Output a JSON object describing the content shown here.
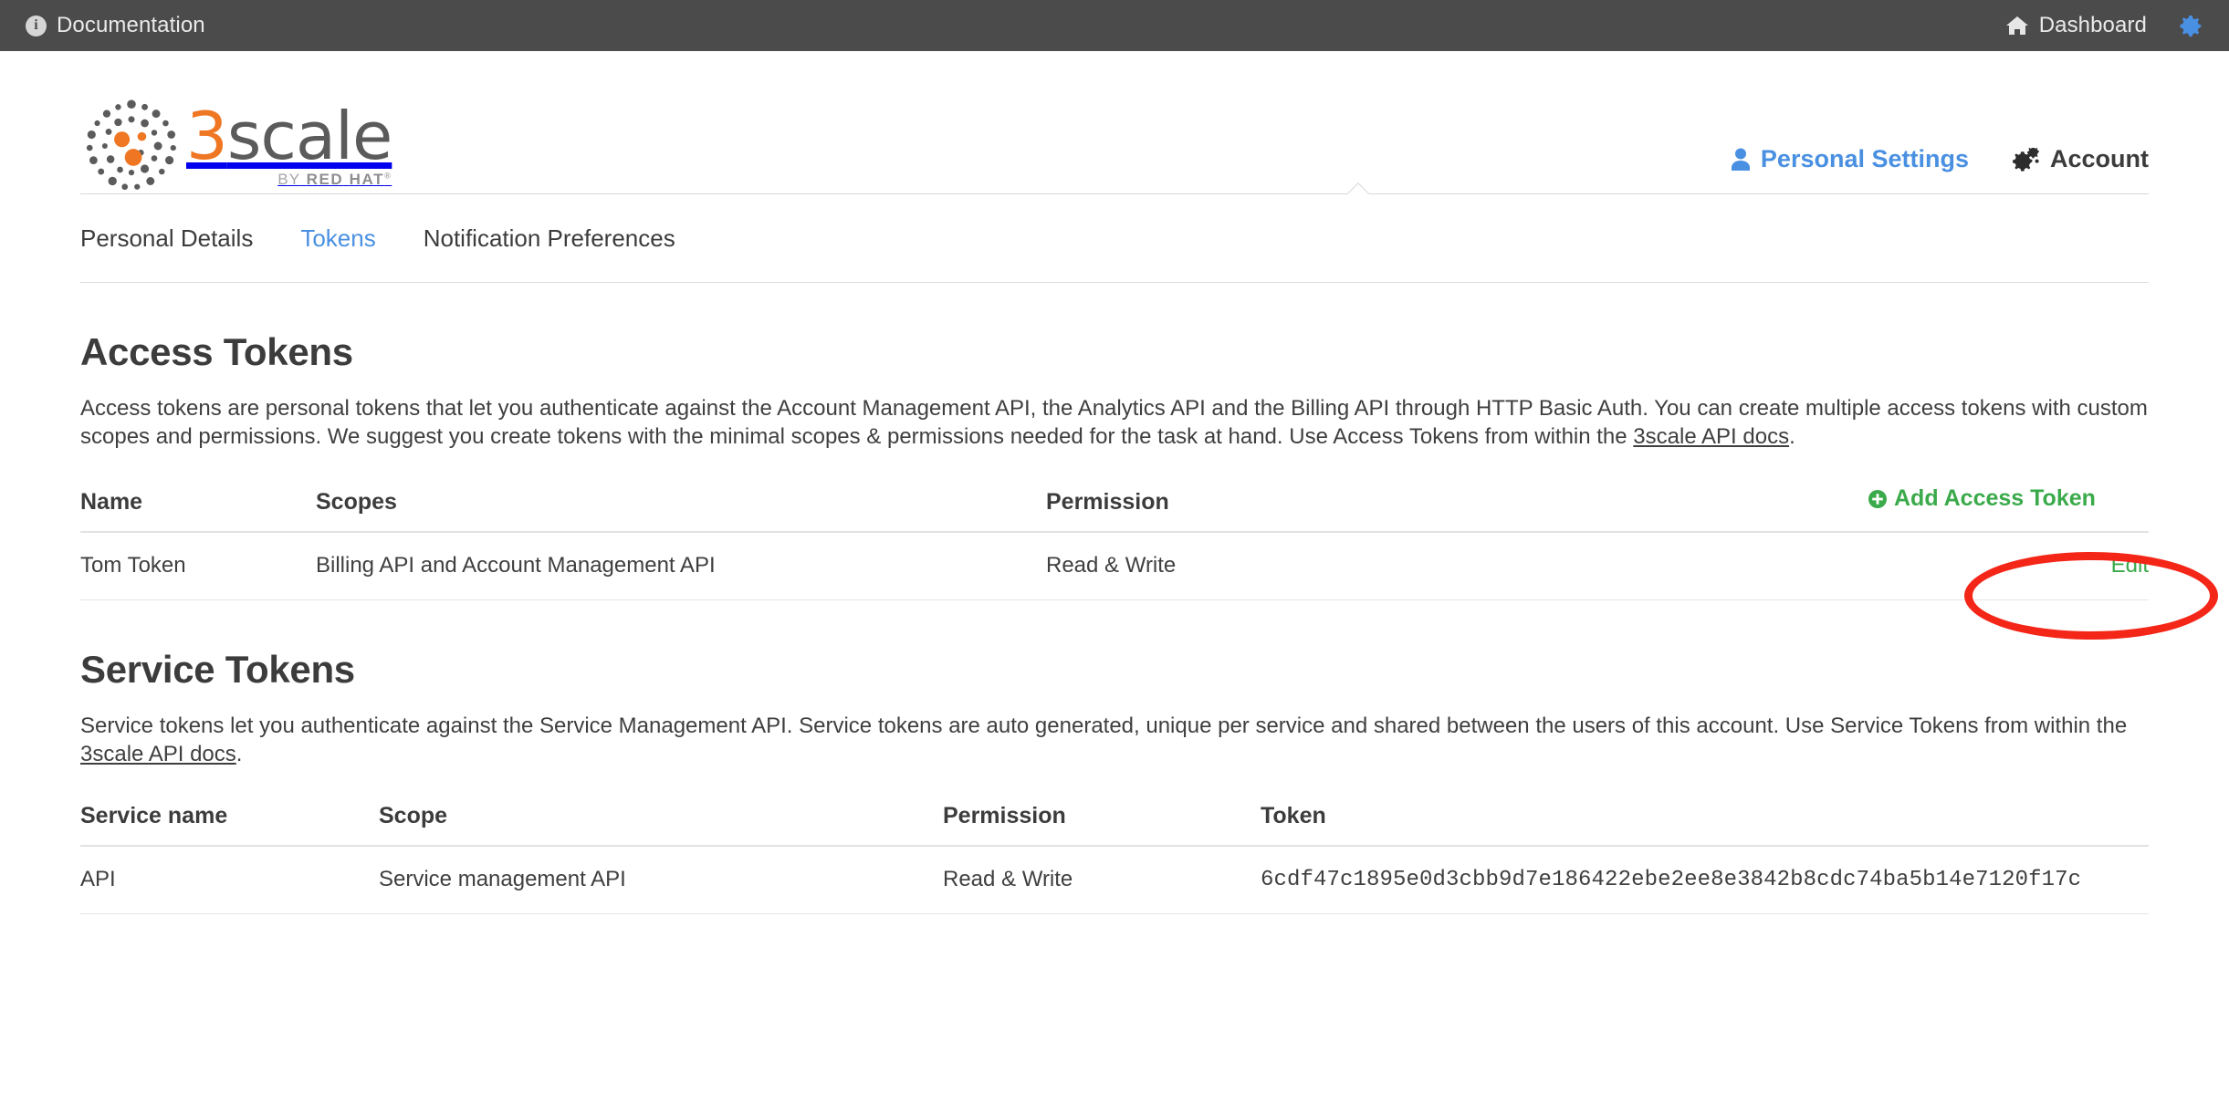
{
  "topbar": {
    "left_items": [
      {
        "label": "Documentation",
        "icon": "info-circle-icon"
      }
    ],
    "right_items": [
      {
        "label": "Dashboard",
        "icon": "home-icon"
      }
    ],
    "settings_icon": "gear-icon",
    "background_color": "#4b4b4b"
  },
  "brand": {
    "name": "3scale",
    "name_prefix": "3",
    "name_rest": "scale",
    "byline_by": "BY",
    "byline_red": "RED",
    "byline_hat": "HAT",
    "byline_mark": "®",
    "orange": "#ef7622",
    "gray": "#5b5b5b"
  },
  "account_nav": {
    "items": [
      {
        "label": "Personal Settings",
        "icon": "person-icon",
        "active": true
      },
      {
        "label": "Account",
        "icon": "gears-icon",
        "active": false
      }
    ],
    "active_color": "#4a90e2"
  },
  "subtabs": {
    "items": [
      {
        "label": "Personal Details",
        "active": false
      },
      {
        "label": "Tokens",
        "active": true
      },
      {
        "label": "Notification Preferences",
        "active": false
      }
    ]
  },
  "access_tokens": {
    "title": "Access Tokens",
    "description_part1": "Access tokens are personal tokens that let you authenticate against the Account Management API, the Analytics API and the Billing API through HTTP Basic Auth. You can create multiple access tokens with custom scopes and permissions. We suggest you create tokens with the minimal scopes & permissions needed for the task at hand. Use Access Tokens from within the ",
    "description_link": "3scale API docs",
    "description_part2": ".",
    "add_button_label": "Add Access Token",
    "add_button_icon": "plus-circle-icon",
    "add_button_color": "#3aaa4a",
    "columns": [
      "Name",
      "Scopes",
      "Permission",
      ""
    ],
    "rows": [
      {
        "name": "Tom Token",
        "scopes": "Billing API and Account Management API",
        "permission": "Read & Write",
        "action_label": "Edit"
      }
    ]
  },
  "service_tokens": {
    "title": "Service Tokens",
    "description_part1": "Service tokens let you authenticate against the Service Management API. Service tokens are auto generated, unique per service and shared between the users of this account. Use Service Tokens from within the ",
    "description_link": "3scale API docs",
    "description_part2": ".",
    "columns": [
      "Service name",
      "Scope",
      "Permission",
      "Token"
    ],
    "rows": [
      {
        "service_name": "API",
        "scope": "Service management API",
        "permission": "Read & Write",
        "token": "6cdf47c1895e0d3cbb9d7e186422ebe2ee8e3842b8cdc74ba5b14e7120f17c"
      }
    ]
  },
  "annotation": {
    "shape": "ellipse",
    "color": "#f42618",
    "target": "Add Access Token"
  }
}
